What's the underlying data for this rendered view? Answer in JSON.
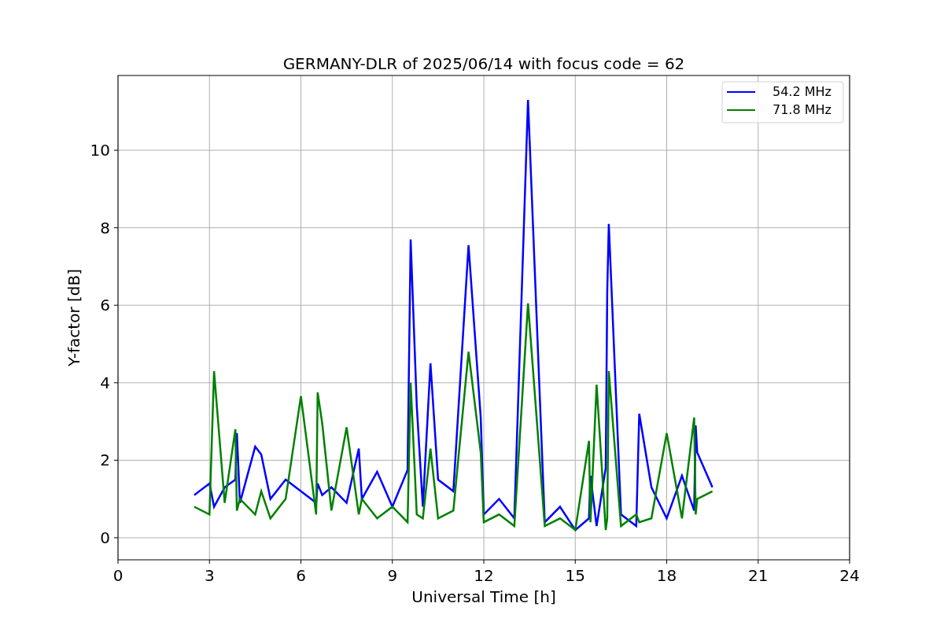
{
  "chart_data": {
    "type": "line",
    "title": "GERMANY-DLR of 2025/06/14 with focus code = 62",
    "xlabel": "Universal Time [h]",
    "ylabel": "Y-factor [dB]",
    "xlim": [
      0,
      24
    ],
    "ylim": [
      -0.57,
      11.93
    ],
    "grid": true,
    "legend": true,
    "xticks": [
      0,
      3,
      6,
      9,
      12,
      15,
      18,
      21,
      24
    ],
    "yticks": [
      0,
      2,
      4,
      6,
      8,
      10
    ],
    "x": [
      2.5,
      3,
      3.15,
      3.5,
      3.85,
      3.9,
      4,
      4.5,
      4.7,
      5,
      5.5,
      6,
      6.5,
      6.55,
      6.7,
      7,
      7.5,
      7.9,
      8,
      8.5,
      9,
      9.5,
      9.6,
      9.8,
      10,
      10.25,
      10.5,
      11,
      11.5,
      11.9,
      12,
      12.5,
      13,
      13.45,
      14,
      14.5,
      15,
      15.45,
      15.5,
      15.7,
      16,
      16.05,
      16.1,
      16.5,
      17,
      17.1,
      17.5,
      18,
      18.5,
      18.9,
      18.95,
      19,
      19.5
    ],
    "series": [
      {
        "name": "54.2 MHz",
        "color": "#0000ff",
        "values": [
          1.1,
          1.4,
          0.8,
          1.3,
          1.5,
          2.7,
          0.9,
          2.35,
          2.15,
          1.0,
          1.5,
          1.2,
          0.9,
          1.4,
          1.1,
          1.3,
          0.9,
          2.3,
          1.0,
          1.7,
          0.8,
          1.75,
          7.7,
          3.4,
          0.8,
          4.5,
          1.5,
          1.2,
          7.55,
          3.1,
          0.6,
          1.0,
          0.5,
          11.3,
          0.4,
          0.8,
          0.2,
          0.5,
          1.6,
          0.3,
          1.8,
          6.35,
          8.1,
          0.6,
          0.3,
          3.2,
          1.3,
          0.5,
          1.6,
          0.7,
          2.9,
          2.2,
          1.3
        ]
      },
      {
        "name": "71.8 MHz",
        "color": "#008000",
        "values": [
          0.8,
          0.6,
          4.3,
          0.9,
          2.8,
          0.7,
          1.0,
          0.6,
          1.2,
          0.5,
          1.0,
          3.65,
          0.6,
          3.75,
          2.95,
          0.7,
          2.85,
          0.6,
          1.0,
          0.5,
          0.8,
          0.4,
          4.0,
          0.6,
          0.5,
          2.3,
          0.5,
          0.7,
          4.8,
          2.2,
          0.4,
          0.6,
          0.3,
          6.05,
          0.3,
          0.5,
          0.2,
          2.5,
          0.4,
          3.95,
          0.2,
          0.5,
          4.3,
          0.3,
          0.6,
          0.4,
          0.5,
          2.7,
          0.5,
          3.1,
          0.6,
          1.0,
          1.2
        ]
      }
    ]
  }
}
